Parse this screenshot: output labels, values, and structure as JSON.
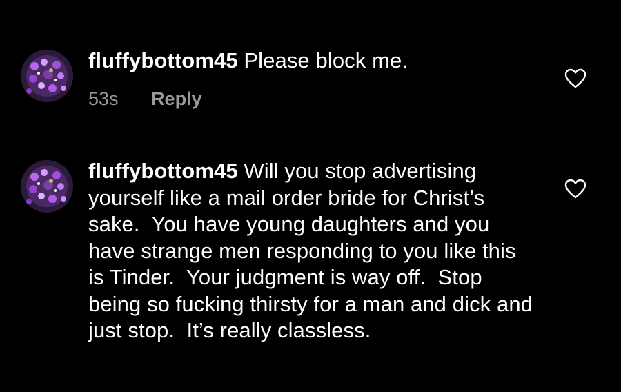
{
  "comments": [
    {
      "username": "fluffybottom45",
      "text": "Please block me.",
      "time": "53s",
      "reply_label": "Reply"
    },
    {
      "username": "fluffybottom45",
      "text": "Will you stop advertising yourself like a mail order bride for Christ’s sake.  You have young daughters and you have strange men responding to you like this is Tinder.  Your judgment is way off.  Stop being so fucking thirsty for a man and dick and just stop.  It’s really classless.",
      "time": "",
      "reply_label": ""
    }
  ],
  "colors": {
    "background": "#000000",
    "text": "#ffffff",
    "meta": "#9a9a9a",
    "avatar_accent": "#a34fd8"
  },
  "icons": {
    "like": "heart-outline-icon",
    "avatar": "purple-flowers-avatar"
  }
}
